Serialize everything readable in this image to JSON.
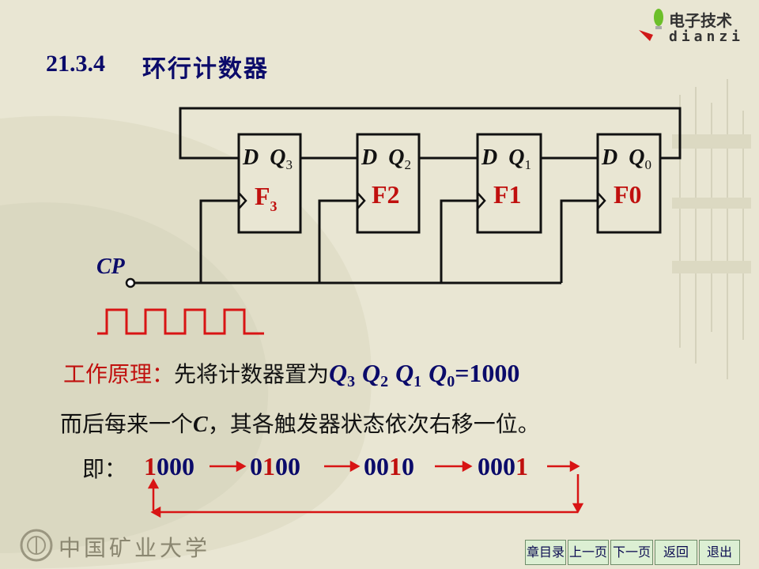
{
  "header": {
    "brand_cn": "电子技术",
    "brand_en": "dianzi"
  },
  "title": {
    "number": "21.3.4",
    "text": "环行计数器"
  },
  "diagram": {
    "flipflops": [
      {
        "pin_d": "D",
        "pin_q": "Q",
        "q_sub": "3",
        "name": "F",
        "name_sub": "3"
      },
      {
        "pin_d": "D",
        "pin_q": "Q",
        "q_sub": "2",
        "name": "F2",
        "name_sub": ""
      },
      {
        "pin_d": "D",
        "pin_q": "Q",
        "q_sub": "1",
        "name": "F1",
        "name_sub": ""
      },
      {
        "pin_d": "D",
        "pin_q": "Q",
        "q_sub": "0",
        "name": "F0",
        "name_sub": ""
      }
    ],
    "clock_label": "CP"
  },
  "principle": {
    "label": "工作原理：",
    "text": "先将计数器置为",
    "q_letter": "Q",
    "q_subs": [
      "3",
      "2",
      "1",
      "0"
    ],
    "equals_value": "=1000"
  },
  "shift_sentence": {
    "before": "而后每来一个",
    "c": "C",
    "after": "，其各触发器状态依次右移一位。"
  },
  "sequence": {
    "prefix": "即：",
    "states": [
      {
        "before": "",
        "one": "1",
        "after": "000"
      },
      {
        "before": "0",
        "one": "1",
        "after": "00"
      },
      {
        "before": "00",
        "one": "1",
        "after": "0"
      },
      {
        "before": "000",
        "one": "1",
        "after": ""
      }
    ]
  },
  "footer": {
    "university": "中国矿业大学"
  },
  "nav": {
    "toc": "章目录",
    "prev": "上一页",
    "next": "下一页",
    "back": "返回",
    "exit": "退出"
  },
  "colors": {
    "accent_red": "#c0100e",
    "title_blue": "#0b0b6a",
    "wire": "#111111",
    "background": "#e9e6d3"
  }
}
